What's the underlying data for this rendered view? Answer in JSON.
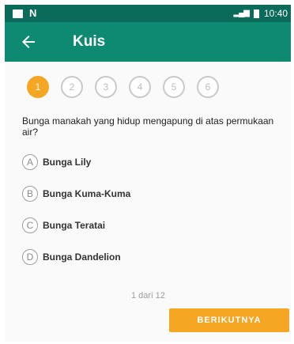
{
  "status_bar": {
    "carrier_icon": "N",
    "time": "10:40"
  },
  "app_bar": {
    "title": "Kuis",
    "back_icon": "arrow-left-icon"
  },
  "steps": [
    "1",
    "2",
    "3",
    "4",
    "5",
    "6"
  ],
  "question": "Bunga manakah yang hidup mengapung di atas permukaan air?",
  "options": [
    {
      "letter": "A",
      "text": "Bunga Lily"
    },
    {
      "letter": "B",
      "text": "Bunga Kuma-Kuma"
    },
    {
      "letter": "C",
      "text": "Bunga Teratai"
    },
    {
      "letter": "D",
      "text": "Bunga Dandelion"
    }
  ],
  "progress_text": "1 dari 12",
  "next_button_label": "BERIKUTNYA",
  "colors": {
    "status_bar": "#0a6b5a",
    "app_bar": "#0f8a72",
    "accent": "#f5a623"
  }
}
